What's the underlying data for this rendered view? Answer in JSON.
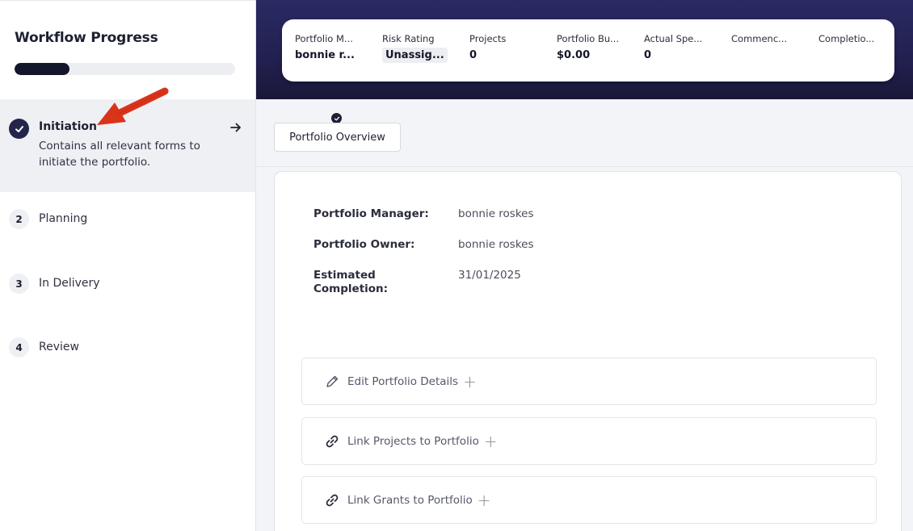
{
  "sidebar": {
    "title": "Workflow Progress",
    "progress_percent": 25,
    "steps": [
      {
        "label": "Initiation",
        "description": "Contains all relevant forms to initiate the portfolio.",
        "state": "complete"
      },
      {
        "number": "2",
        "label": "Planning"
      },
      {
        "number": "3",
        "label": "In Delivery"
      },
      {
        "number": "4",
        "label": "Review"
      }
    ]
  },
  "summary": {
    "items": [
      {
        "label": "Portfolio M...",
        "value": "bonnie r..."
      },
      {
        "label": "Risk Rating",
        "value": "Unassig..."
      },
      {
        "label": "Projects",
        "value": "0"
      },
      {
        "label": "Portfolio Bu...",
        "value": "$0.00"
      },
      {
        "label": "Actual Spe...",
        "value": "0"
      },
      {
        "label": "Commenc...",
        "value": ""
      },
      {
        "label": "Completio...",
        "value": ""
      }
    ]
  },
  "tabs": [
    {
      "label": "Portfolio Overview",
      "completed": true
    }
  ],
  "details": [
    {
      "label": "Portfolio Manager:",
      "value": "bonnie roskes"
    },
    {
      "label": "Portfolio Owner:",
      "value": "bonnie roskes"
    },
    {
      "label": "Estimated Completion:",
      "value": "31/01/2025"
    }
  ],
  "actions": [
    {
      "label": "Edit Portfolio Details",
      "icon": "pencil-icon"
    },
    {
      "label": "Link Projects to Portfolio",
      "icon": "link-icon"
    },
    {
      "label": "Link Grants to Portfolio",
      "icon": "link-icon"
    }
  ],
  "colors": {
    "banner": "#232152",
    "progress_fill": "#14162b",
    "annotation_arrow": "#d9331a"
  }
}
